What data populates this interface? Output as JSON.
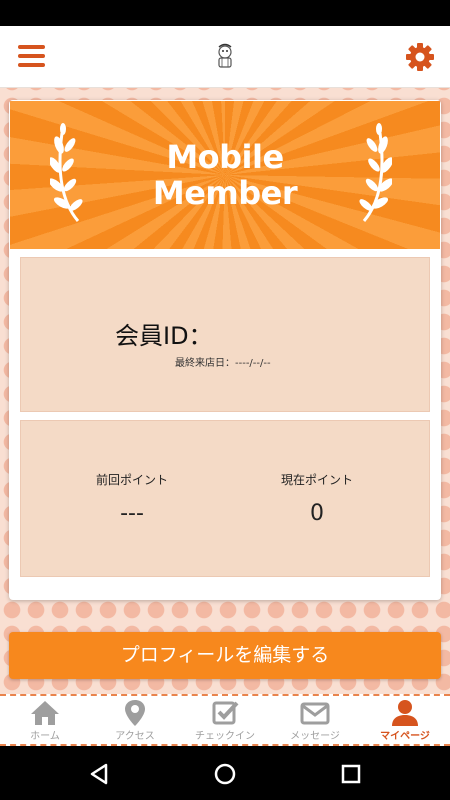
{
  "header": {
    "menu_icon": "hamburger-menu-icon",
    "logo_icon": "mascot-logo-icon",
    "settings_icon": "gear-icon"
  },
  "banner": {
    "title_line1": "Mobile",
    "title_line2": "Member"
  },
  "member": {
    "id_label": "会員ID：",
    "id_value": "",
    "last_visit_label": "最終来店日：",
    "last_visit_value": "----/--/--"
  },
  "points": {
    "previous_label": "前回ポイント",
    "previous_value": "---",
    "current_label": "現在ポイント",
    "current_value": "0"
  },
  "edit_profile_label": "プロフィールを編集する",
  "bottom_nav": [
    {
      "label": "ホーム",
      "icon": "home-icon"
    },
    {
      "label": "アクセス",
      "icon": "map-pin-icon"
    },
    {
      "label": "チェックイン",
      "icon": "checkbox-icon"
    },
    {
      "label": "メッセージ",
      "icon": "envelope-icon"
    },
    {
      "label": "マイページ",
      "icon": "user-icon",
      "active": true
    }
  ],
  "colors": {
    "accent": "#f7881d",
    "accent_dark": "#d6541e",
    "panel": "#f4dac6",
    "background": "#f9dfd2"
  }
}
